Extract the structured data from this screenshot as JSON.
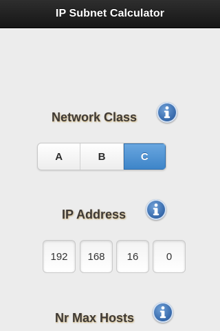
{
  "header": {
    "title": "IP Subnet Calculator"
  },
  "network_class": {
    "title": "Network Class",
    "info_icon": "info-icon",
    "options": [
      "A",
      "B",
      "C"
    ],
    "selected": "C"
  },
  "ip_address": {
    "title": "IP Address",
    "info_icon": "info-icon",
    "octets": [
      "192",
      "168",
      "16",
      "0"
    ]
  },
  "max_hosts": {
    "title": "Nr Max Hosts",
    "info_icon": "info-icon"
  },
  "colors": {
    "header_bg": "#1f1f1f",
    "page_bg": "#ececec",
    "active_segment": "#4a8fd0",
    "info_icon": "#3c6fb0"
  }
}
